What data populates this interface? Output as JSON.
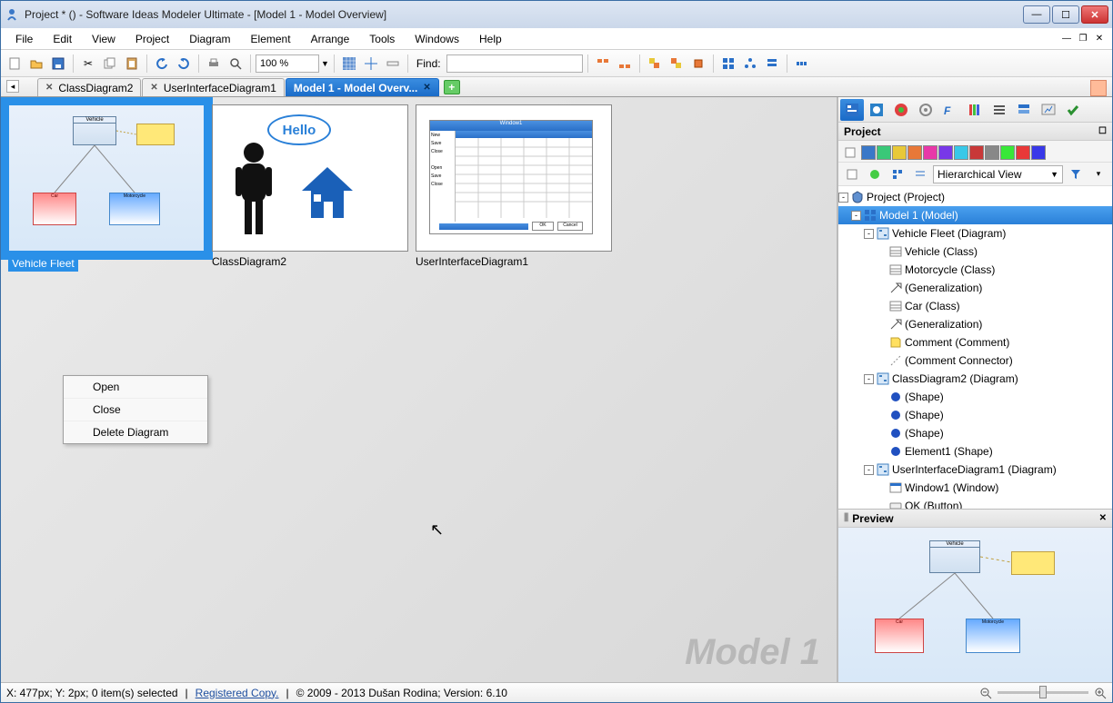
{
  "window": {
    "title": "Project *  () - Software Ideas Modeler Ultimate - [Model 1 - Model Overview]"
  },
  "menu": {
    "items": [
      "File",
      "Edit",
      "View",
      "Project",
      "Diagram",
      "Element",
      "Arrange",
      "Tools",
      "Windows",
      "Help"
    ]
  },
  "toolbar": {
    "zoom": "100 %",
    "findLabel": "Find:"
  },
  "tabs": [
    {
      "label": "ClassDiagram2",
      "active": false
    },
    {
      "label": "UserInterfaceDiagram1",
      "active": false
    },
    {
      "label": "Model 1 - Model Overv...",
      "active": true
    }
  ],
  "thumbnails": [
    {
      "label": "Vehicle Fleet",
      "selected": true
    },
    {
      "label": "ClassDiagram2",
      "selected": false
    },
    {
      "label": "UserInterfaceDiagram1",
      "selected": false
    }
  ],
  "contextMenu": {
    "items": [
      "Open",
      "Close",
      "Delete Diagram"
    ]
  },
  "watermark": "Model 1",
  "projectPanel": {
    "title": "Project",
    "viewMode": "Hierarchical View",
    "tree": [
      {
        "depth": 0,
        "exp": "-",
        "icon": "proj",
        "label": "Project (Project)"
      },
      {
        "depth": 1,
        "exp": "-",
        "icon": "model",
        "label": "Model 1 (Model)",
        "sel": true
      },
      {
        "depth": 2,
        "exp": "-",
        "icon": "diag",
        "label": "Vehicle Fleet (Diagram)"
      },
      {
        "depth": 3,
        "exp": "",
        "icon": "class",
        "label": "Vehicle (Class)"
      },
      {
        "depth": 3,
        "exp": "",
        "icon": "class",
        "label": "Motorcycle (Class)"
      },
      {
        "depth": 3,
        "exp": "",
        "icon": "gen",
        "label": "(Generalization)"
      },
      {
        "depth": 3,
        "exp": "",
        "icon": "class",
        "label": "Car (Class)"
      },
      {
        "depth": 3,
        "exp": "",
        "icon": "gen",
        "label": "(Generalization)"
      },
      {
        "depth": 3,
        "exp": "",
        "icon": "comment",
        "label": "Comment (Comment)"
      },
      {
        "depth": 3,
        "exp": "",
        "icon": "conn",
        "label": "(Comment Connector)"
      },
      {
        "depth": 2,
        "exp": "-",
        "icon": "diag",
        "label": "ClassDiagram2 (Diagram)"
      },
      {
        "depth": 3,
        "exp": "",
        "icon": "shape",
        "label": "(Shape)"
      },
      {
        "depth": 3,
        "exp": "",
        "icon": "shape",
        "label": "(Shape)"
      },
      {
        "depth": 3,
        "exp": "",
        "icon": "shape",
        "label": "(Shape)"
      },
      {
        "depth": 3,
        "exp": "",
        "icon": "shape",
        "label": "Element1 (Shape)"
      },
      {
        "depth": 2,
        "exp": "-",
        "icon": "diag",
        "label": "UserInterfaceDiagram1 (Diagram)"
      },
      {
        "depth": 3,
        "exp": "",
        "icon": "win",
        "label": "Window1 (Window)"
      },
      {
        "depth": 3,
        "exp": "",
        "icon": "btn",
        "label": "OK (Button)"
      }
    ]
  },
  "previewPanel": {
    "title": "Preview"
  },
  "status": {
    "coords": "X: 477px; Y: 2px; 0 item(s) selected",
    "link": "Registered Copy.",
    "copyright": "© 2009 - 2013 Dušan Rodina; Version: 6.10"
  },
  "miniDiagram": {
    "hello": "Hello",
    "vehicle": "Vehicle",
    "car": "Car",
    "motorcycle": "Motorcycle",
    "window": "Window1",
    "ok": "OK",
    "cancel": "Cancel"
  },
  "colors": [
    "#3a78c8",
    "#3ac878",
    "#e8c838",
    "#e87838",
    "#e838a8",
    "#7838e8",
    "#38c8e8",
    "#c83838",
    "#888",
    "#38e838",
    "#e83838",
    "#3838e8"
  ]
}
